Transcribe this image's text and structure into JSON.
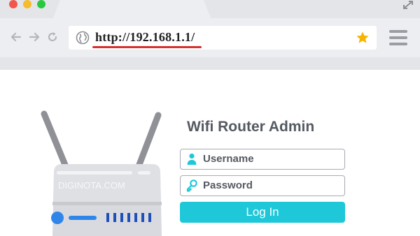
{
  "browser": {
    "url": "http://192.168.1.1/",
    "colors": {
      "url_underline": "#d93030",
      "star": "#f5b500",
      "chrome": "#e4e5e9"
    }
  },
  "router": {
    "watermark": "DIGINOTA.COM",
    "colors": {
      "body": "#d9dadf",
      "led": "#2f86e8",
      "ports": "#1f4fb8",
      "antenna": "#8f9197"
    }
  },
  "login": {
    "title": "Wifi Router Admin",
    "username_placeholder": "Username",
    "password_placeholder": "Password",
    "button_label": "Log In",
    "colors": {
      "button": "#1fc8d8",
      "icon": "#1fc8d8"
    }
  },
  "icons": {
    "window_controls": [
      "close-dot",
      "minimize-dot",
      "maximize-dot"
    ],
    "nav": [
      "back-arrow-icon",
      "forward-arrow-icon",
      "reload-icon"
    ],
    "address": [
      "globe-icon",
      "star-icon"
    ],
    "menu": "hamburger-menu-icon",
    "fields": [
      "user-icon",
      "key-icon"
    ]
  }
}
